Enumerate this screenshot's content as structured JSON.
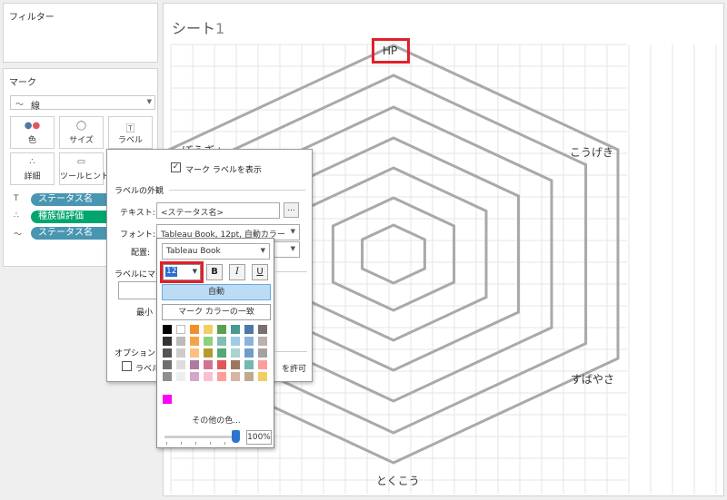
{
  "filters": {
    "title": "フィルター"
  },
  "marks": {
    "title": "マーク",
    "mark_type": "線",
    "buttons": [
      {
        "label": "色",
        "icon": "color-dots-icon"
      },
      {
        "label": "サイズ",
        "icon": "size-icon"
      },
      {
        "label": "ラベル",
        "icon": "label-icon"
      },
      {
        "label": "詳細",
        "icon": "detail-icon"
      },
      {
        "label": "ツールヒント",
        "icon": "tooltip-icon"
      }
    ],
    "pills": [
      {
        "icon": "T",
        "label": "ステータス名",
        "color": "#4996b2"
      },
      {
        "icon": "∴",
        "label": "種族値評価",
        "color": "#00a66e"
      },
      {
        "icon": "〜",
        "label": "ステータス名",
        "color": "#4996b2"
      }
    ]
  },
  "sheet": {
    "title": "シート",
    "number": "1",
    "axes": [
      "HP",
      "こうげき",
      "すばやさ",
      "とくこう",
      "ぼうぎょ"
    ]
  },
  "label_popup": {
    "show_labels": "マーク ラベルを表示",
    "appearance_section": "ラベルの外観",
    "text_label": "テキスト:",
    "text_value": "<ステータス名>",
    "more_button": "...",
    "font_label": "フォント:",
    "font_value": "Tableau Book, 12pt, 自動カラー",
    "align_label": "配置:",
    "label_marks": "ラベルにマーク",
    "min_label": "最小",
    "options_section": "オプション",
    "options_check_left": "ラベル",
    "options_check_right": "を許可"
  },
  "font_popup": {
    "font_family": "Tableau Book",
    "size": "12",
    "bold": "B",
    "italic": "I",
    "underline": "U",
    "auto": "自動",
    "match_mark_color": "マーク カラーの一致",
    "more_colors": "その他の色...",
    "opacity": "100%",
    "swatch_rows": [
      [
        "#000000",
        "#ffffff",
        "#f28e2b",
        "#f1ce63",
        "#59a14f",
        "#499894",
        "#4e79a7",
        "#79706e"
      ],
      [
        "#333333",
        "#bbbbbb",
        "#f5a34a",
        "#8cd17d",
        "#86bcb6",
        "#a0cbe8",
        "#8cb4d8",
        "#bab0ac"
      ],
      [
        "#555555",
        "#cccccc",
        "#ffbe7d",
        "#b6992d",
        "#54a877",
        "#a8d5d0",
        "#6e9dc9",
        "#a5a19f"
      ],
      [
        "#6f6f6f",
        "#dddddd",
        "#b07aa1",
        "#d37295",
        "#e15759",
        "#9d7660",
        "#76b7b2",
        "#ff9d9a"
      ],
      [
        "#8f8f8f",
        "#eeeeee",
        "#d4a6c8",
        "#fabfd2",
        "#ff9d9a",
        "#d7b5a6",
        "#bfaa8f",
        "#f1ce63"
      ]
    ],
    "custom_color": "#ff00ff"
  },
  "colors": {
    "highlight": "#e0202a",
    "grid": "#a9a9a9",
    "pill_blue": "#4996b2",
    "pill_green": "#00a66e"
  }
}
